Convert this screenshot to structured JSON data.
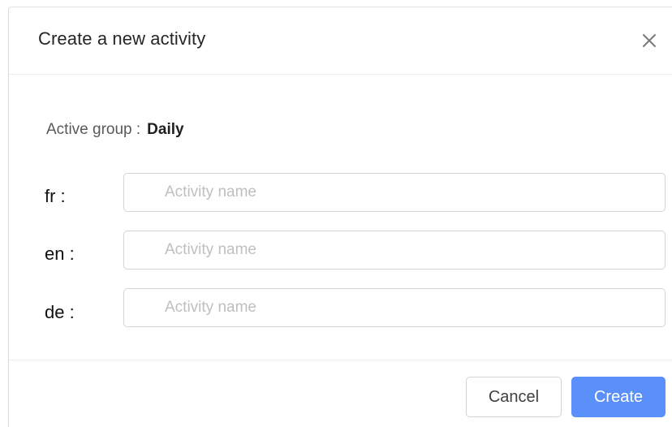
{
  "dialog": {
    "title": "Create a new activity",
    "close_icon": "close-icon"
  },
  "active_group": {
    "label": "Active group :",
    "value": "Daily"
  },
  "languages": [
    {
      "code_label": "fr :",
      "placeholder": "Activity name",
      "value": ""
    },
    {
      "code_label": "en :",
      "placeholder": "Activity name",
      "value": ""
    },
    {
      "code_label": "de :",
      "placeholder": "Activity name",
      "value": ""
    }
  ],
  "footer": {
    "cancel_label": "Cancel",
    "create_label": "Create"
  },
  "colors": {
    "primary": "#5b8ff9",
    "border": "#d4d4d4",
    "placeholder": "#bfbfbf"
  }
}
